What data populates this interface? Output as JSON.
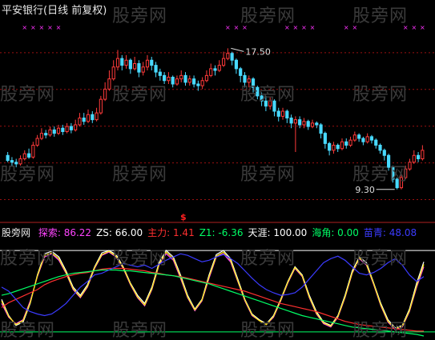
{
  "title": "平安银行(日线 前复权)",
  "watermark": "股旁网",
  "colors": {
    "up": "#ff3a3a",
    "down": "#48d9ff",
    "bg": "#000000",
    "grid": "#9b1010",
    "marker": "#ff33ff"
  },
  "chart_data": [
    {
      "type": "candlestick",
      "name": "平安银行(日线 前复权)",
      "ylim": [
        7.5,
        19.5
      ],
      "high_label": "17.50",
      "low_label": "9.30",
      "signal_label": "$",
      "candles": [
        [
          11.3,
          11.0,
          11.5,
          10.9
        ],
        [
          11.0,
          10.9,
          11.2,
          10.7
        ],
        [
          10.9,
          10.8,
          11.1,
          10.6
        ],
        [
          10.8,
          11.1,
          11.3,
          10.7
        ],
        [
          11.1,
          11.4,
          11.6,
          11.0
        ],
        [
          11.4,
          11.2,
          11.7,
          11.1
        ],
        [
          11.2,
          11.9,
          12.1,
          11.1
        ],
        [
          11.9,
          12.3,
          12.5,
          11.8
        ],
        [
          12.3,
          12.6,
          12.9,
          12.2
        ],
        [
          12.6,
          12.5,
          12.8,
          12.3
        ],
        [
          12.5,
          12.8,
          13.0,
          12.4
        ],
        [
          12.8,
          12.6,
          13.0,
          12.4
        ],
        [
          12.6,
          12.9,
          13.1,
          12.5
        ],
        [
          12.9,
          12.7,
          13.1,
          12.5
        ],
        [
          12.7,
          13.0,
          13.2,
          12.6
        ],
        [
          13.0,
          12.8,
          13.2,
          12.6
        ],
        [
          12.8,
          13.1,
          13.4,
          12.7
        ],
        [
          13.1,
          13.5,
          13.8,
          13.0
        ],
        [
          13.5,
          13.3,
          13.8,
          13.1
        ],
        [
          13.3,
          13.7,
          14.0,
          13.2
        ],
        [
          13.7,
          13.4,
          13.9,
          13.2
        ],
        [
          13.4,
          13.8,
          14.1,
          13.3
        ],
        [
          13.8,
          14.6,
          14.8,
          13.7
        ],
        [
          14.6,
          15.2,
          15.6,
          14.5
        ],
        [
          15.2,
          15.8,
          16.3,
          15.1
        ],
        [
          15.8,
          16.5,
          16.9,
          15.7
        ],
        [
          16.5,
          17.0,
          17.5,
          16.3
        ],
        [
          17.0,
          16.6,
          17.2,
          16.3
        ],
        [
          16.6,
          16.9,
          17.2,
          16.4
        ],
        [
          16.9,
          16.4,
          17.0,
          16.1
        ],
        [
          16.4,
          16.7,
          17.1,
          16.3
        ],
        [
          16.7,
          16.2,
          16.9,
          15.9
        ],
        [
          16.2,
          16.5,
          16.8,
          16.0
        ],
        [
          16.5,
          16.9,
          17.2,
          16.3
        ],
        [
          16.9,
          16.6,
          17.1,
          16.3
        ],
        [
          16.6,
          16.2,
          16.8,
          15.9
        ],
        [
          16.2,
          16.0,
          16.4,
          15.7
        ],
        [
          16.0,
          15.7,
          16.2,
          15.5
        ],
        [
          15.7,
          15.9,
          16.2,
          15.5
        ],
        [
          15.9,
          15.5,
          16.0,
          15.3
        ],
        [
          15.5,
          15.8,
          16.0,
          15.4
        ],
        [
          15.8,
          16.0,
          16.3,
          15.6
        ],
        [
          16.0,
          15.6,
          16.2,
          15.4
        ],
        [
          15.6,
          15.8,
          16.0,
          15.4
        ],
        [
          15.8,
          15.5,
          16.0,
          15.3
        ],
        [
          15.5,
          15.4,
          15.7,
          15.1
        ],
        [
          15.4,
          15.7,
          15.9,
          15.2
        ],
        [
          15.7,
          16.0,
          16.3,
          15.6
        ],
        [
          16.0,
          16.4,
          16.7,
          15.9
        ],
        [
          16.4,
          16.3,
          16.6,
          16.0
        ],
        [
          16.3,
          16.6,
          16.9,
          16.2
        ],
        [
          16.6,
          17.0,
          17.4,
          16.5
        ],
        [
          17.0,
          17.3,
          17.6,
          16.9
        ],
        [
          17.3,
          16.9,
          17.4,
          16.6
        ],
        [
          16.9,
          16.4,
          17.0,
          16.1
        ],
        [
          16.4,
          16.0,
          16.5,
          15.6
        ],
        [
          16.0,
          15.6,
          16.2,
          15.3
        ],
        [
          15.6,
          15.8,
          16.0,
          15.3
        ],
        [
          15.8,
          15.3,
          15.9,
          15.0
        ],
        [
          15.3,
          14.8,
          15.4,
          14.6
        ],
        [
          14.8,
          14.5,
          15.0,
          14.2
        ],
        [
          14.5,
          14.2,
          14.8,
          13.9
        ],
        [
          14.2,
          14.5,
          14.7,
          14.0
        ],
        [
          14.5,
          13.9,
          14.6,
          13.6
        ],
        [
          13.9,
          13.6,
          14.1,
          13.3
        ],
        [
          13.6,
          13.9,
          14.1,
          13.4
        ],
        [
          13.9,
          13.5,
          14.0,
          13.2
        ],
        [
          13.5,
          13.2,
          13.7,
          12.9
        ],
        [
          13.2,
          13.4,
          13.6,
          11.5
        ],
        [
          13.4,
          13.1,
          13.6,
          12.9
        ],
        [
          13.1,
          13.3,
          13.5,
          12.9
        ],
        [
          13.3,
          13.0,
          13.4,
          12.8
        ],
        [
          13.0,
          13.2,
          13.4,
          12.9
        ],
        [
          13.2,
          13.1,
          13.3,
          12.9
        ],
        [
          13.1,
          12.6,
          13.2,
          12.3
        ],
        [
          12.6,
          12.0,
          12.7,
          11.7
        ],
        [
          12.0,
          11.6,
          12.1,
          11.3
        ],
        [
          11.6,
          11.9,
          12.1,
          11.4
        ],
        [
          11.9,
          11.7,
          12.0,
          11.5
        ],
        [
          11.7,
          12.1,
          12.3,
          11.6
        ],
        [
          12.1,
          11.9,
          12.3,
          11.7
        ],
        [
          11.9,
          12.2,
          12.4,
          11.8
        ],
        [
          12.2,
          12.5,
          12.7,
          12.1
        ],
        [
          12.5,
          12.3,
          12.6,
          12.1
        ],
        [
          12.3,
          12.1,
          12.4,
          11.9
        ],
        [
          12.1,
          12.4,
          12.6,
          12.0
        ],
        [
          12.4,
          12.2,
          12.5,
          12.0
        ],
        [
          12.2,
          11.9,
          12.3,
          11.7
        ],
        [
          11.9,
          11.6,
          12.0,
          11.4
        ],
        [
          11.6,
          11.3,
          11.7,
          11.0
        ],
        [
          11.3,
          10.6,
          11.4,
          10.4
        ],
        [
          10.6,
          9.9,
          10.7,
          9.7
        ],
        [
          9.9,
          9.4,
          10.0,
          9.3
        ],
        [
          9.4,
          10.0,
          10.2,
          9.3
        ],
        [
          10.0,
          10.5,
          10.7,
          9.9
        ],
        [
          10.5,
          10.9,
          11.1,
          10.4
        ],
        [
          10.9,
          11.3,
          11.6,
          10.8
        ],
        [
          11.3,
          11.1,
          11.5,
          10.9
        ],
        [
          11.1,
          11.6,
          11.9,
          11.0
        ]
      ]
    },
    {
      "type": "line",
      "name": "股旁网",
      "indicators": [
        {
          "label": "探索:",
          "value": "86.22",
          "color": "#ff44ff"
        },
        {
          "label": "ZS:",
          "value": "66.00",
          "color": "#ffffff"
        },
        {
          "label": "主力:",
          "value": "1.41",
          "color": "#ff3030"
        },
        {
          "label": "Z1:",
          "value": "-6.36",
          "color": "#00ff66"
        },
        {
          "label": "天涯:",
          "value": "100.00",
          "color": "#ffffff"
        },
        {
          "label": "海角:",
          "value": "0.00",
          "color": "#00ff66"
        },
        {
          "label": "苗青:",
          "value": "48.08",
          "color": "#3b3bff"
        }
      ],
      "ylim": [
        -5,
        105
      ],
      "series": [
        {
          "color": "#ffffff",
          "values": [
            40,
            20,
            8,
            12,
            35,
            70,
            96,
            99,
            92,
            75,
            55,
            45,
            58,
            80,
            97,
            100,
            95,
            80,
            60,
            45,
            35,
            55,
            85,
            100,
            92,
            70,
            45,
            28,
            40,
            70,
            95,
            100,
            90,
            65,
            40,
            22,
            15,
            10,
            20,
            40,
            62,
            80,
            70,
            45,
            25,
            12,
            8,
            20,
            45,
            75,
            92,
            85,
            60,
            35,
            15,
            5,
            8,
            28,
            60,
            86
          ]
        },
        {
          "color": "#ff44ff",
          "values": [
            35,
            18,
            10,
            15,
            38,
            68,
            92,
            96,
            88,
            72,
            52,
            42,
            55,
            78,
            94,
            98,
            92,
            78,
            58,
            42,
            32,
            52,
            82,
            96,
            88,
            66,
            42,
            26,
            38,
            66,
            92,
            96,
            86,
            62,
            38,
            20,
            14,
            9,
            18,
            38,
            60,
            78,
            68,
            42,
            22,
            10,
            6,
            18,
            42,
            72,
            90,
            82,
            58,
            32,
            12,
            3,
            6,
            25,
            55,
            80
          ]
        },
        {
          "color": "#ffee00",
          "values": [
            38,
            19,
            9,
            14,
            36,
            69,
            94,
            97,
            90,
            73,
            53,
            43,
            56,
            79,
            95,
            99,
            93,
            79,
            59,
            43,
            33,
            53,
            83,
            98,
            90,
            68,
            43,
            27,
            39,
            68,
            93,
            98,
            88,
            63,
            39,
            21,
            14,
            9,
            19,
            39,
            61,
            79,
            69,
            43,
            23,
            11,
            7,
            19,
            43,
            73,
            91,
            83,
            59,
            33,
            13,
            4,
            7,
            26,
            57,
            83
          ]
        },
        {
          "color": "#ff3030",
          "values": [
            30,
            36,
            40,
            44,
            48,
            52,
            58,
            62,
            65,
            68,
            70,
            72,
            73,
            75,
            77,
            78,
            78,
            78,
            77,
            76,
            75,
            73,
            72,
            70,
            69,
            68,
            66,
            64,
            62,
            60,
            58,
            56,
            54,
            52,
            50,
            47,
            44,
            41,
            38,
            35,
            33,
            31,
            29,
            27,
            25,
            22,
            19,
            16,
            13,
            11,
            9,
            8,
            7,
            6,
            5,
            4,
            3,
            2,
            1,
            1
          ]
        },
        {
          "color": "#00ff66",
          "values": [
            45,
            47,
            50,
            53,
            56,
            59,
            62,
            65,
            68,
            70,
            72,
            73,
            74,
            75,
            76,
            76,
            76,
            75,
            75,
            74,
            73,
            72,
            71,
            70,
            69,
            67,
            65,
            63,
            61,
            59,
            56,
            53,
            50,
            47,
            44,
            41,
            38,
            35,
            32,
            29,
            26,
            23,
            20,
            18,
            16,
            14,
            12,
            10,
            8,
            6,
            5,
            4,
            3,
            2,
            1,
            0,
            -1,
            -2,
            -3,
            -5
          ]
        },
        {
          "color": "#3b3bff",
          "values": [
            55,
            50,
            40,
            30,
            25,
            22,
            20,
            22,
            28,
            35,
            45,
            55,
            62,
            70,
            72,
            76,
            80,
            84,
            82,
            80,
            82,
            78,
            83,
            88,
            92,
            96,
            94,
            90,
            86,
            88,
            92,
            95,
            90,
            84,
            75,
            66,
            58,
            52,
            48,
            45,
            46,
            48,
            55,
            65,
            75,
            85,
            90,
            93,
            88,
            80,
            72,
            70,
            73,
            78,
            85,
            90,
            82,
            70,
            62,
            68
          ]
        }
      ],
      "thresholds": [
        {
          "value": 100,
          "color": "#ffffff"
        },
        {
          "value": 0,
          "color": "#00ff66"
        }
      ]
    }
  ]
}
